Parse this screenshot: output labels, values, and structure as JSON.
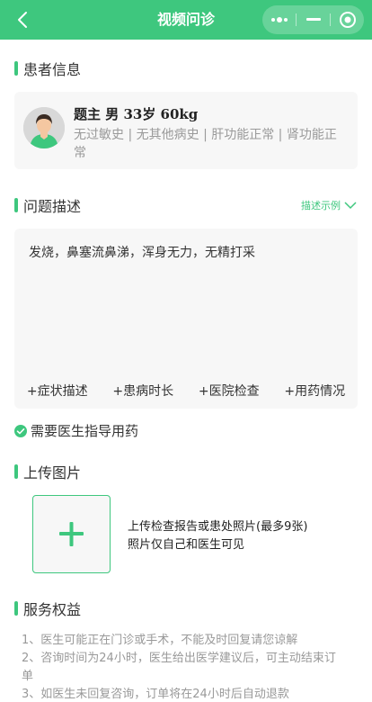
{
  "nav": {
    "title": "视频问诊",
    "back_icon": "chevron-left-icon",
    "more_icon": "more-dots-icon",
    "minimize_icon": "minimize-icon",
    "close_icon": "target-circle-icon"
  },
  "colors": {
    "accent": "#3ec77e",
    "card_bg": "#f7f7f7",
    "muted_text": "#9a9a9a"
  },
  "patient_section": {
    "title": "患者信息",
    "avatar_icon": "user-avatar-icon",
    "name_line": "题主 男 33岁 60kg",
    "tags": "无过敏史 | 无其他病史 | 肝功能正常 | 肾功能正常"
  },
  "problem_section": {
    "title": "问题描述",
    "example_label": "描述示例",
    "example_icon": "chevron-down-icon",
    "description": "发烧，鼻塞流鼻涕，浑身无力，无精打采",
    "chips": [
      "+症状描述",
      "+患病时长",
      "+医院检查",
      "+用药情况"
    ]
  },
  "doctor_guide": {
    "label": "需要医生指导用药",
    "checked": true,
    "icon": "check-circle-icon"
  },
  "upload_section": {
    "title": "上传图片",
    "add_icon": "plus-icon",
    "hint_line1": "上传检查报告或患处照片(最多9张)",
    "hint_line2": "照片仅自己和医生可见"
  },
  "service_section": {
    "title": "服务权益",
    "items": [
      "1、医生可能正在门诊或手术，不能及时回复请您谅解",
      "2、咨询时间为24小时，医生给出医学建议后，可主动结束订单",
      "3、如医生未回复咨询，订单将在24小时后自动退款"
    ]
  }
}
